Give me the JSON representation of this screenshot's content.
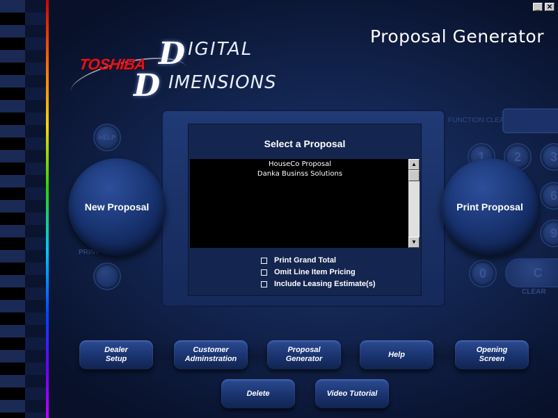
{
  "window": {
    "title": "Proposal Generator",
    "minimize_glyph": "_",
    "close_glyph": "✕"
  },
  "logo": {
    "brand": "TOSHIBA",
    "line1_initial": "D",
    "line1_rest": "IGITAL",
    "line2_initial": "D",
    "line2_rest": "IMENSIONS"
  },
  "background_panel": {
    "help": "HELP",
    "print": "PRINT",
    "function_clear": "FUNCTION CLEAR",
    "keys": [
      "1",
      "2",
      "3",
      "6",
      "9",
      "0",
      "C"
    ],
    "clear": "CLEAR"
  },
  "panel": {
    "title": "Select a Proposal",
    "proposals": [
      "HouseCo Proposal",
      "Danka Businss Solutions"
    ],
    "options": [
      {
        "label": "Print Grand Total",
        "checked": false
      },
      {
        "label": "Omit Line Item Pricing",
        "checked": false
      },
      {
        "label": "Include Leasing Estimate(s)",
        "checked": false
      }
    ],
    "scroll_up_glyph": "▲",
    "scroll_down_glyph": "▼"
  },
  "actions": {
    "new_proposal": "New Proposal",
    "print_proposal": "Print Proposal"
  },
  "nav": {
    "dealer_setup": "Dealer\nSetup",
    "customer_admin": "Customer\nAdminstration",
    "proposal_generator": "Proposal\nGenerator",
    "help": "Help",
    "opening_screen": "Opening\nScreen",
    "delete": "Delete",
    "video_tutorial": "Video Tutorial"
  },
  "colors": {
    "background": "#132652",
    "panel": "#14264f",
    "list_background": "#000000",
    "brand_red": "#e0151c",
    "text": "#ffffff"
  }
}
